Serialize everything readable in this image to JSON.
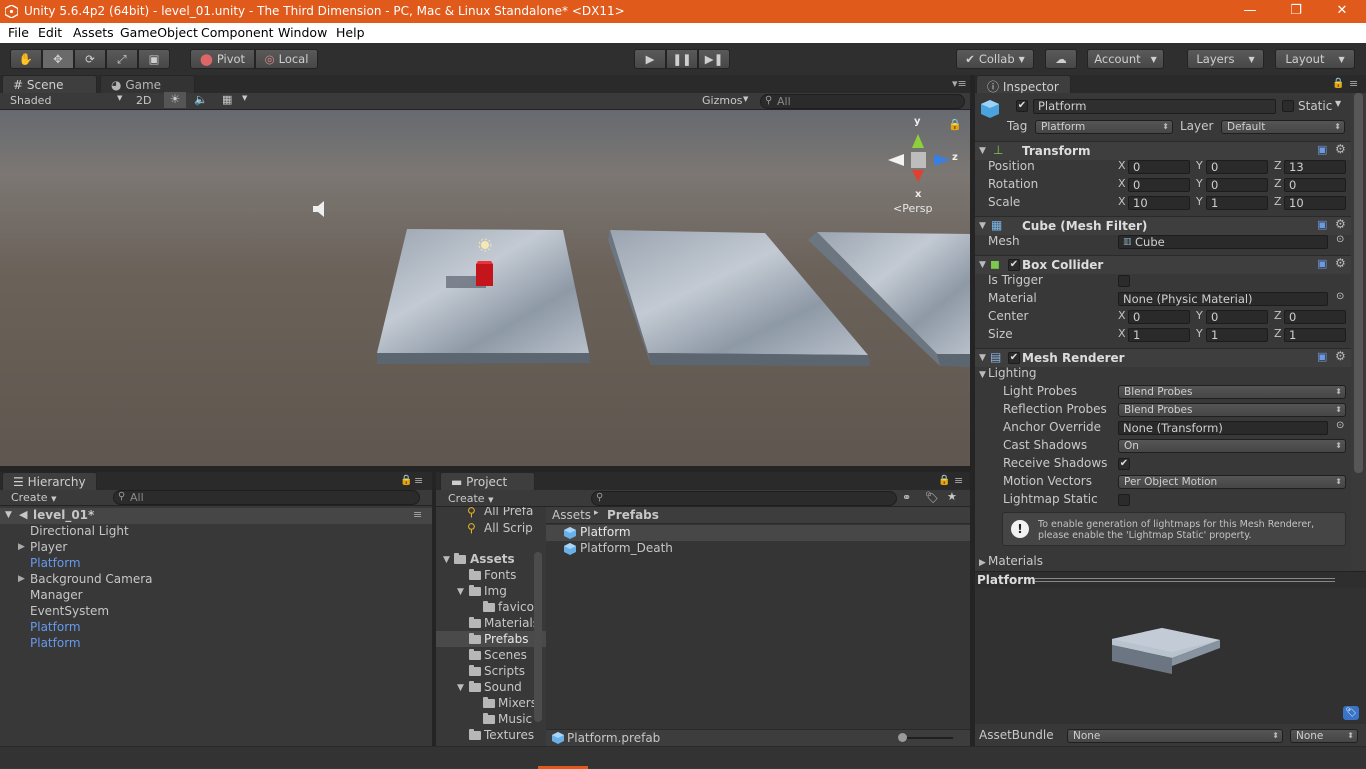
{
  "window": {
    "title": "Unity 5.6.4p2 (64bit) - level_01.unity - The Third Dimension - PC, Mac & Linux Standalone* <DX11>",
    "minimize_glyph": "—",
    "restore_glyph": "❐",
    "close_glyph": "✕"
  },
  "menu": [
    "File",
    "Edit",
    "Assets",
    "GameObject",
    "Component",
    "Window",
    "Help"
  ],
  "toolbar": {
    "pivot": "Pivot",
    "local": "Local",
    "collab": "Collab",
    "account": "Account",
    "layers": "Layers",
    "layout": "Layout"
  },
  "scene": {
    "tab": "Scene",
    "game_tab": "Game",
    "shading": "Shaded",
    "mode_2d": "2D",
    "gizmos": "Gizmos",
    "search_placeholder": "All",
    "persp": "Persp",
    "gizmo_y": "y",
    "gizmo_z": "z",
    "gizmo_x": "x"
  },
  "hierarchy": {
    "tab": "Hierarchy",
    "create": "Create",
    "search_placeholder": "All",
    "scene_name": "level_01*",
    "items": [
      {
        "label": "Directional Light",
        "expandable": false,
        "prefab": false
      },
      {
        "label": "Player",
        "expandable": true,
        "prefab": false
      },
      {
        "label": "Platform",
        "expandable": false,
        "prefab": true
      },
      {
        "label": "Background Camera",
        "expandable": true,
        "prefab": false
      },
      {
        "label": "Manager",
        "expandable": false,
        "prefab": false
      },
      {
        "label": "EventSystem",
        "expandable": false,
        "prefab": false
      },
      {
        "label": "Platform",
        "expandable": false,
        "prefab": true
      },
      {
        "label": "Platform",
        "expandable": false,
        "prefab": true
      }
    ]
  },
  "project": {
    "tab": "Project",
    "create": "Create",
    "favorites": [
      "All Prefa",
      "All Scrip"
    ],
    "tree": [
      "Assets",
      "Fonts",
      "Img",
      "favico",
      "Materials",
      "Prefabs",
      "Scenes",
      "Scripts",
      "Sound",
      "Mixers",
      "Music",
      "Textures"
    ],
    "breadcrumb_root": "Assets",
    "breadcrumb_sep": "▸",
    "breadcrumb_current": "Prefabs",
    "files": [
      "Platform",
      "Platform_Death"
    ],
    "footer_file": "Platform.prefab"
  },
  "inspector": {
    "tab": "Inspector",
    "object_name": "Platform",
    "static_label": "Static",
    "tag_label": "Tag",
    "tag_value": "Platform",
    "layer_label": "Layer",
    "layer_value": "Default",
    "transform": {
      "title": "Transform",
      "rows": [
        {
          "label": "Position",
          "x": "0",
          "y": "0",
          "z": "13"
        },
        {
          "label": "Rotation",
          "x": "0",
          "y": "0",
          "z": "0"
        },
        {
          "label": "Scale",
          "x": "10",
          "y": "1",
          "z": "10"
        }
      ]
    },
    "mesh_filter": {
      "title": "Cube (Mesh Filter)",
      "mesh_label": "Mesh",
      "mesh_value": "Cube"
    },
    "box_collider": {
      "title": "Box Collider",
      "is_trigger_label": "Is Trigger",
      "material_label": "Material",
      "material_value": "None (Physic Material)",
      "center_label": "Center",
      "center": {
        "x": "0",
        "y": "0",
        "z": "0"
      },
      "size_label": "Size",
      "size": {
        "x": "1",
        "y": "1",
        "z": "1"
      }
    },
    "mesh_renderer": {
      "title": "Mesh Renderer",
      "lighting_label": "Lighting",
      "light_probes_label": "Light Probes",
      "light_probes_value": "Blend Probes",
      "reflection_probes_label": "Reflection Probes",
      "reflection_probes_value": "Blend Probes",
      "anchor_override_label": "Anchor Override",
      "anchor_override_value": "None (Transform)",
      "cast_shadows_label": "Cast Shadows",
      "cast_shadows_value": "On",
      "receive_shadows_label": "Receive Shadows",
      "motion_vectors_label": "Motion Vectors",
      "motion_vectors_value": "Per Object Motion",
      "lightmap_static_label": "Lightmap Static",
      "info_line1": "To enable generation of lightmaps for this Mesh Renderer,",
      "info_line2": "please enable the 'Lightmap Static' property."
    },
    "materials_label": "Materials",
    "preview_title": "Platform",
    "assetbundle_label": "AssetBundle",
    "assetbundle_value": "None",
    "assetbundle_variant": "None"
  },
  "colors": {
    "titlebar": "#e05a1b",
    "prefab_blue": "#6699ee"
  }
}
